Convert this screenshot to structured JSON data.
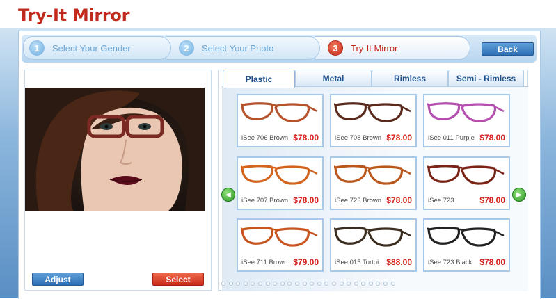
{
  "app": {
    "title": "Try-It Mirror"
  },
  "steps": [
    {
      "number": "1",
      "label": "Select Your Gender"
    },
    {
      "number": "2",
      "label": "Select Your Photo"
    },
    {
      "number": "3",
      "label": "Try-It Mirror"
    }
  ],
  "buttons": {
    "back": "Back",
    "adjust": "Adjust",
    "select": "Select"
  },
  "tabs": [
    "Plastic",
    "Metal",
    "Rimless",
    "Semi - Rimless"
  ],
  "active_tab": "Plastic",
  "products": [
    {
      "name": "iSee 706 Brown",
      "price": "$78.00",
      "frame_color": "#b4532c"
    },
    {
      "name": "iSee 708 Brown",
      "price": "$78.00",
      "frame_color": "#5a2a1c"
    },
    {
      "name": "iSee 011 Purple",
      "price": "$78.00",
      "frame_color": "#b44fb0"
    },
    {
      "name": "iSee 707 Brown",
      "price": "$78.00",
      "frame_color": "#d2641e"
    },
    {
      "name": "iSee 723 Brown",
      "price": "$78.00",
      "frame_color": "#b9571c"
    },
    {
      "name": "iSee 723",
      "price": "$78.00",
      "frame_color": "#7a2418"
    },
    {
      "name": "iSee 711 Brown",
      "price": "$79.00",
      "frame_color": "#c8541e"
    },
    {
      "name": "iSee 015 Tortoi...",
      "price": "$88.00",
      "frame_color": "#3b2d20"
    },
    {
      "name": "iSee 723 Black",
      "price": "$78.00",
      "frame_color": "#222222"
    }
  ],
  "pagination": {
    "total_pages": 24,
    "current_page": 1
  },
  "colors": {
    "title_red": "#c22a1e",
    "price_red": "#d6201a",
    "button_blue": "#2d6fb4",
    "button_red": "#c8291a"
  }
}
